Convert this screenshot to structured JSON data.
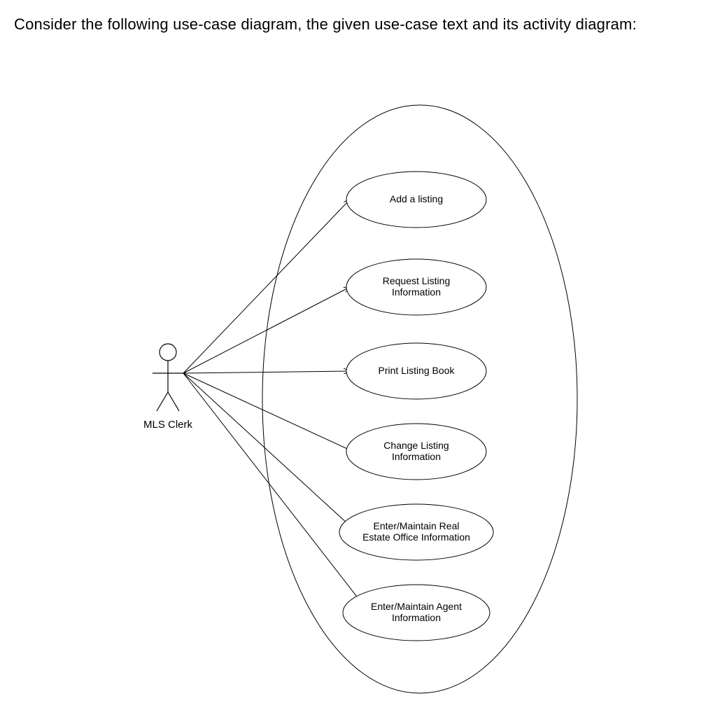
{
  "prompt": "Consider the following use-case diagram, the given use-case text and its activity diagram:",
  "diagram": {
    "actor": {
      "name": "MLS Clerk"
    },
    "useCases": [
      {
        "label": "Add a listing"
      },
      {
        "label": "Request Listing Information",
        "lines": [
          "Request Listing",
          "Information"
        ]
      },
      {
        "label": "Print Listing Book"
      },
      {
        "label": "Change Listing Information",
        "lines": [
          "Change Listing",
          "Information"
        ]
      },
      {
        "label": "Enter/Maintain Real Estate Office Information",
        "lines": [
          "Enter/Maintain Real",
          "Estate Office Information"
        ]
      },
      {
        "label": "Enter/Maintain Agent Information",
        "lines": [
          "Enter/Maintain Agent",
          "Information"
        ]
      }
    ]
  }
}
